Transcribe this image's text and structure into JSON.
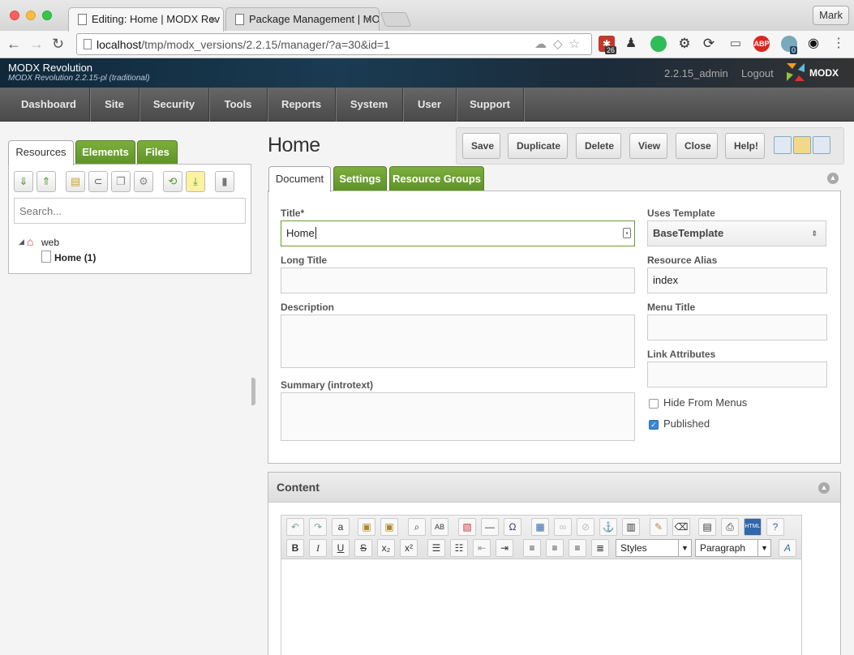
{
  "browser": {
    "tabs": [
      {
        "title": "Editing: Home | MODX Rev"
      },
      {
        "title": "Package Management | MO"
      }
    ],
    "user_button": "Mark",
    "url_host": "localhost",
    "url_path": "/tmp/modx_versions/2.2.15/manager/?a=30&id=1",
    "ext_badge_1": "26",
    "ext_badge_2": "0",
    "abp_label": "ABP"
  },
  "header": {
    "title": "MODX Revolution",
    "subtitle": "MODX Revolution 2.2.15-pl (traditional)",
    "username": "2.2.15_admin",
    "logout": "Logout",
    "logo_text": "MODX"
  },
  "nav": [
    "Dashboard",
    "Site",
    "Security",
    "Tools",
    "Reports",
    "System",
    "User",
    "Support"
  ],
  "left": {
    "tabs": [
      "Resources",
      "Elements",
      "Files"
    ],
    "search_placeholder": "Search...",
    "tree": {
      "root": "web",
      "child": "Home",
      "child_id": "(1)"
    }
  },
  "page_title": "Home",
  "actions": [
    "Save",
    "Duplicate",
    "Delete",
    "View",
    "Close",
    "Help!"
  ],
  "form_tabs": [
    "Document",
    "Settings",
    "Resource Groups"
  ],
  "form": {
    "title_label": "Title*",
    "title_value": "Home",
    "long_title_label": "Long Title",
    "description_label": "Description",
    "summary_label": "Summary (introtext)",
    "template_label": "Uses Template",
    "template_value": "BaseTemplate",
    "alias_label": "Resource Alias",
    "alias_value": "index",
    "menu_title_label": "Menu Title",
    "link_attr_label": "Link Attributes",
    "hide_menus_label": "Hide From Menus",
    "hide_menus_checked": false,
    "published_label": "Published",
    "published_checked": true
  },
  "content": {
    "title": "Content",
    "styles_select": "Styles",
    "format_select": "Paragraph"
  },
  "colors": {
    "accent_green": "#6a9b2e",
    "header_dark": "#1a3b52",
    "nav_gray": "#555555"
  }
}
